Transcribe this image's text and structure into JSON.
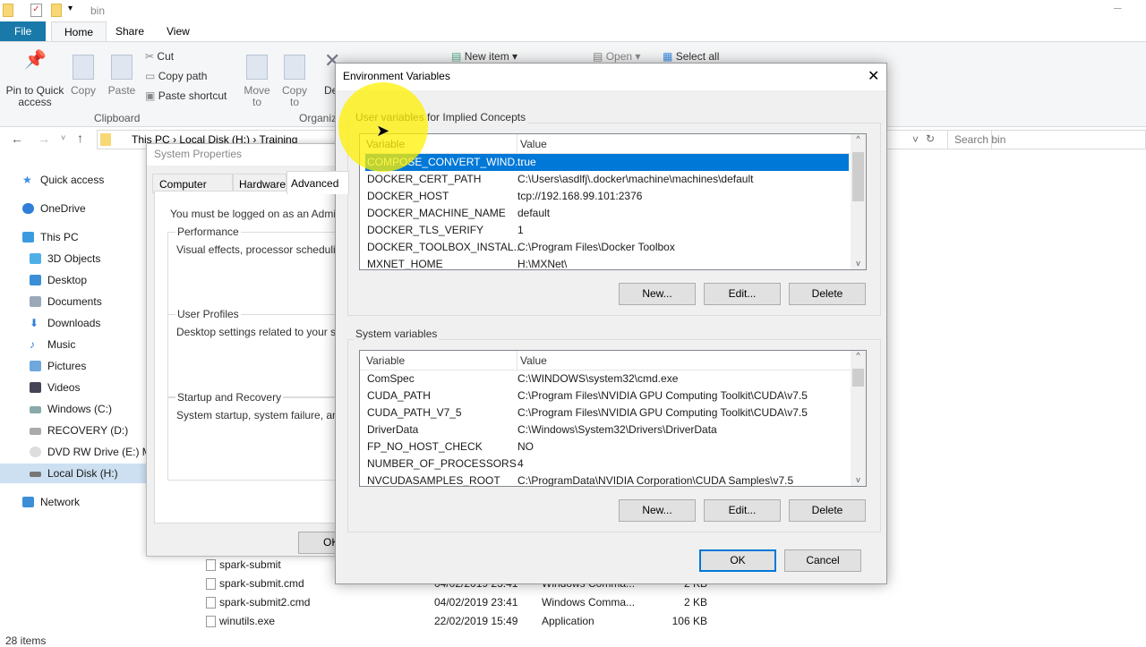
{
  "explorer": {
    "title": "bin",
    "tabs": [
      "File",
      "Home",
      "Share",
      "View"
    ],
    "ribbon": {
      "pin": "Pin to Quick access",
      "copy": "Copy",
      "paste": "Paste",
      "cut": "Cut",
      "copy_path": "Copy path",
      "paste_shortcut": "Paste shortcut",
      "clipboard": "Clipboard",
      "move_to": "Move to",
      "copy_to": "Copy to",
      "delete": "De",
      "organize": "Organiz",
      "new_item": "New item",
      "open": "Open",
      "select_all": "Select all"
    },
    "breadcrumb": [
      "This PC",
      "Local Disk (H:)",
      "Training"
    ],
    "search_placeholder": "Search bin",
    "nav": [
      "Quick access",
      "OneDrive",
      "This PC",
      "3D Objects",
      "Desktop",
      "Documents",
      "Downloads",
      "Music",
      "Pictures",
      "Videos",
      "Windows (C:)",
      "RECOVERY (D:)",
      "DVD RW Drive (E:) My",
      "Local Disk (H:)",
      "Network"
    ],
    "files": [
      {
        "name": "spark-submit",
        "date": "",
        "type": "",
        "size": ""
      },
      {
        "name": "spark-submit.cmd",
        "date": "04/02/2019 23:41",
        "type": "Windows Comma...",
        "size": "2 KB"
      },
      {
        "name": "spark-submit2.cmd",
        "date": "04/02/2019 23:41",
        "type": "Windows Comma...",
        "size": "2 KB"
      },
      {
        "name": "winutils.exe",
        "date": "22/02/2019 15:49",
        "type": "Application",
        "size": "106 KB"
      }
    ],
    "status": "28 items"
  },
  "system_properties": {
    "title": "System Properties",
    "tabs": [
      "Computer Name",
      "Hardware",
      "Advanced"
    ],
    "admin_note": "You must be logged on as an Administra",
    "performance": {
      "label": "Performance",
      "text": "Visual effects, processor scheduling, m"
    },
    "user_profiles": {
      "label": "User Profiles",
      "text": "Desktop settings related to your sign-in"
    },
    "startup": {
      "label": "Startup and Recovery",
      "text": "System startup, system failure, and deb"
    },
    "ok": "OK"
  },
  "env": {
    "title": "Environment Variables",
    "user_label": "User variables for Implied Concepts",
    "col_variable": "Variable",
    "col_value": "Value",
    "user_vars": [
      [
        "COMPOSE_CONVERT_WIND...",
        "true"
      ],
      [
        "DOCKER_CERT_PATH",
        "C:\\Users\\asdlfj\\.docker\\machine\\machines\\default"
      ],
      [
        "DOCKER_HOST",
        "tcp://192.168.99.101:2376"
      ],
      [
        "DOCKER_MACHINE_NAME",
        "default"
      ],
      [
        "DOCKER_TLS_VERIFY",
        "1"
      ],
      [
        "DOCKER_TOOLBOX_INSTAL...",
        "C:\\Program Files\\Docker Toolbox"
      ],
      [
        "MXNET_HOME",
        "H:\\MXNet\\"
      ]
    ],
    "system_label": "System variables",
    "system_vars": [
      [
        "ComSpec",
        "C:\\WINDOWS\\system32\\cmd.exe"
      ],
      [
        "CUDA_PATH",
        "C:\\Program Files\\NVIDIA GPU Computing Toolkit\\CUDA\\v7.5"
      ],
      [
        "CUDA_PATH_V7_5",
        "C:\\Program Files\\NVIDIA GPU Computing Toolkit\\CUDA\\v7.5"
      ],
      [
        "DriverData",
        "C:\\Windows\\System32\\Drivers\\DriverData"
      ],
      [
        "FP_NO_HOST_CHECK",
        "NO"
      ],
      [
        "NUMBER_OF_PROCESSORS",
        "4"
      ],
      [
        "NVCUDASAMPLES_ROOT",
        "C:\\ProgramData\\NVIDIA Corporation\\CUDA Samples\\v7.5"
      ]
    ],
    "new": "New...",
    "edit": "Edit...",
    "delete": "Delete",
    "ok": "OK",
    "cancel": "Cancel"
  },
  "colors": {
    "accent": "#0078d7",
    "file_tab": "#1979a9",
    "highlight": "#ffff00"
  }
}
